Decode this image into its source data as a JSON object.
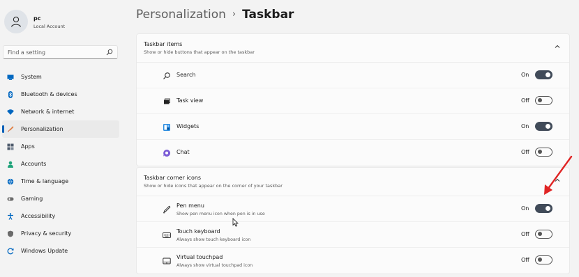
{
  "user": {
    "name": "pc",
    "account_type": "Local Account"
  },
  "search": {
    "placeholder": "Find a setting",
    "icon": "search-icon"
  },
  "nav": {
    "items": [
      {
        "label": "System",
        "icon": "system-icon",
        "color": "#0067c0"
      },
      {
        "label": "Bluetooth & devices",
        "icon": "bluetooth-icon",
        "color": "#0067c0"
      },
      {
        "label": "Network & internet",
        "icon": "wifi-icon",
        "color": "#0067c0"
      },
      {
        "label": "Personalization",
        "icon": "brush-icon",
        "color": "#e07a3a",
        "active": true
      },
      {
        "label": "Apps",
        "icon": "apps-icon",
        "color": "#4d5a6b"
      },
      {
        "label": "Accounts",
        "icon": "accounts-icon",
        "color": "#1fa37a"
      },
      {
        "label": "Time & language",
        "icon": "globe-icon",
        "color": "#0067c0"
      },
      {
        "label": "Gaming",
        "icon": "gaming-icon",
        "color": "#6b6b6b"
      },
      {
        "label": "Accessibility",
        "icon": "accessibility-icon",
        "color": "#0067c0"
      },
      {
        "label": "Privacy & security",
        "icon": "shield-icon",
        "color": "#6b6b6b"
      },
      {
        "label": "Windows Update",
        "icon": "update-icon",
        "color": "#0067c0"
      }
    ]
  },
  "header": {
    "parent": "Personalization",
    "current": "Taskbar",
    "separator": "›"
  },
  "sections": [
    {
      "title": "Taskbar items",
      "subtitle": "Show or hide buttons that appear on the taskbar",
      "rows": [
        {
          "label": "Search",
          "state": "On",
          "on": true,
          "icon": "search-icon"
        },
        {
          "label": "Task view",
          "state": "Off",
          "on": false,
          "icon": "task-view-icon"
        },
        {
          "label": "Widgets",
          "state": "On",
          "on": true,
          "icon": "widgets-icon"
        },
        {
          "label": "Chat",
          "state": "Off",
          "on": false,
          "icon": "chat-icon"
        }
      ]
    },
    {
      "title": "Taskbar corner icons",
      "subtitle": "Show or hide icons that appear on the corner of your taskbar",
      "rows": [
        {
          "label": "Pen menu",
          "desc": "Show pen menu icon when pen is in use",
          "state": "On",
          "on": true,
          "icon": "pen-icon"
        },
        {
          "label": "Touch keyboard",
          "desc": "Always show touch keyboard icon",
          "state": "Off",
          "on": false,
          "icon": "keyboard-icon"
        },
        {
          "label": "Virtual touchpad",
          "desc": "Always show virtual touchpad icon",
          "state": "Off",
          "on": false,
          "icon": "touchpad-icon"
        }
      ]
    }
  ],
  "colors": {
    "accent": "#005fb8",
    "toggle_on": "#414b59",
    "annotation_arrow": "#e02424"
  }
}
